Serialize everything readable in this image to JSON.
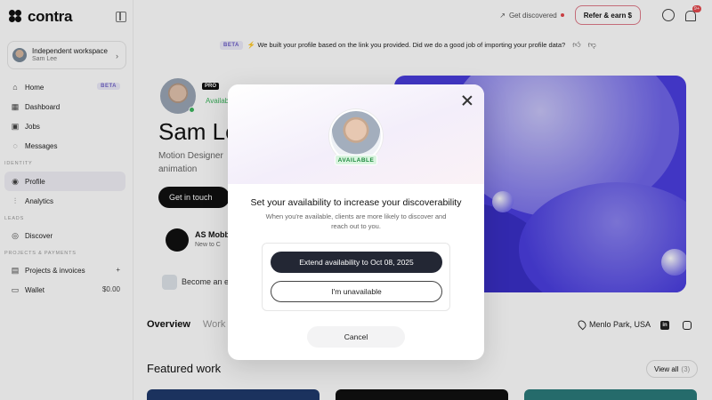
{
  "app": {
    "logo_text": "contra"
  },
  "workspace": {
    "title": "Independent workspace",
    "subtitle": "Sam Lee"
  },
  "sidebar": {
    "items": [
      {
        "label": "Home",
        "badge": "BETA"
      },
      {
        "label": "Dashboard"
      },
      {
        "label": "Jobs"
      },
      {
        "label": "Messages"
      }
    ],
    "section_identity": "IDENTITY",
    "identity_items": [
      {
        "label": "Profile",
        "active": true
      },
      {
        "label": "Analytics"
      }
    ],
    "section_leads": "LEADS",
    "leads_items": [
      {
        "label": "Discover"
      }
    ],
    "section_payments": "PROJECTS & PAYMENTS",
    "payments_items": [
      {
        "label": "Projects & invoices",
        "right": "+"
      },
      {
        "label": "Wallet",
        "right": "$0.00"
      }
    ]
  },
  "topbar": {
    "get_discovered": "Get discovered",
    "refer_label": "Refer & earn $",
    "notif_count": "9+"
  },
  "banner": {
    "badge": "BETA",
    "text": "⚡ We built your profile based on the link you provided. Did we do a good job of importing your profile data?"
  },
  "profile": {
    "pro_tag": "PRO",
    "availability": "Available",
    "name": "Sam Lee",
    "role_line1": "Motion Designer",
    "role_line2": "animation",
    "cta": "Get in touch",
    "company_name": "AS Mobb",
    "company_sub": "New to C",
    "expert_text": "Become an e"
  },
  "tabs": [
    {
      "label": "Overview",
      "active": true
    },
    {
      "label": "Work"
    }
  ],
  "location": "Menlo Park, USA",
  "featured": {
    "title": "Featured work",
    "view_all": "View all",
    "count": "(3)"
  },
  "modal": {
    "badge": "AVAILABLE",
    "title": "Set your availability to increase your discoverability",
    "description": "When you're available, clients are more likely to discover and reach out to you.",
    "primary_button": "Extend availability to Oct 08, 2025",
    "secondary_button": "I'm unavailable",
    "cancel_button": "Cancel"
  },
  "colors": {
    "accent": "#4a3ee0",
    "available_green": "#3cb55e",
    "refer_border": "#e07b8a",
    "primary_dark": "#232734"
  }
}
